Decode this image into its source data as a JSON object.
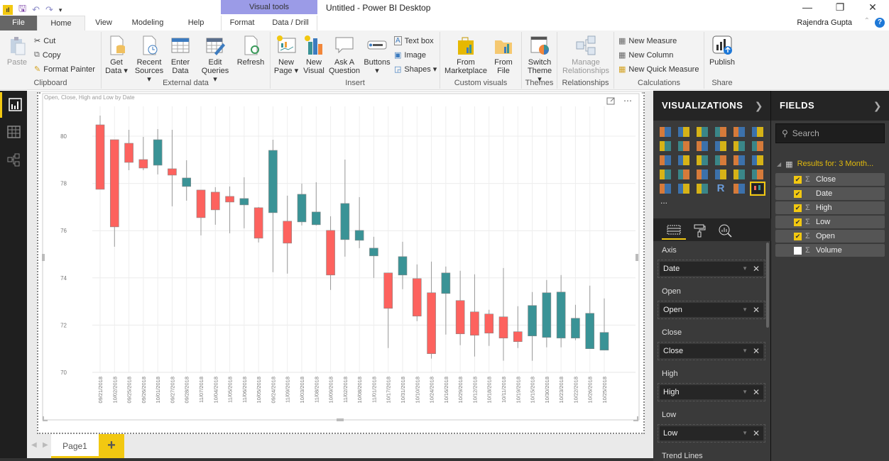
{
  "window": {
    "title": "Untitled - Power BI Desktop",
    "contextual_group": "Visual tools",
    "controls": [
      "minimize",
      "restore",
      "close"
    ],
    "user": "Rajendra Gupta"
  },
  "tabs": [
    {
      "label": "File",
      "active": false
    },
    {
      "label": "Home",
      "active": true
    },
    {
      "label": "View",
      "active": false
    },
    {
      "label": "Modeling",
      "active": false
    },
    {
      "label": "Help",
      "active": false
    },
    {
      "label": "Format",
      "active": false
    },
    {
      "label": "Data / Drill",
      "active": false
    }
  ],
  "ribbon": {
    "clipboard": {
      "label": "Clipboard",
      "paste": "Paste",
      "cut": "Cut",
      "copy": "Copy",
      "format_painter": "Format Painter"
    },
    "external_data": {
      "label": "External data",
      "get_data": [
        "Get",
        "Data ▾"
      ],
      "recent_sources": [
        "Recent",
        "Sources ▾"
      ],
      "enter_data": [
        "Enter",
        "Data"
      ],
      "edit_queries": [
        "Edit",
        "Queries ▾"
      ],
      "refresh": "Refresh"
    },
    "insert": {
      "label": "Insert",
      "new_page": [
        "New",
        "Page ▾"
      ],
      "new_visual": [
        "New",
        "Visual"
      ],
      "ask_question": [
        "Ask A",
        "Question"
      ],
      "buttons": [
        "Buttons",
        "▾"
      ],
      "text_box": "Text box",
      "image": "Image",
      "shapes": "Shapes ▾"
    },
    "custom_visuals": {
      "label": "Custom visuals",
      "from_marketplace": [
        "From",
        "Marketplace"
      ],
      "from_file": [
        "From",
        "File"
      ]
    },
    "themes": {
      "label": "Themes",
      "switch_theme": [
        "Switch",
        "Theme ▾"
      ]
    },
    "relationships": {
      "label": "Relationships",
      "manage": [
        "Manage",
        "Relationships"
      ]
    },
    "calculations": {
      "label": "Calculations",
      "new_measure": "New Measure",
      "new_column": "New Column",
      "new_quick_measure": "New Quick Measure"
    },
    "share": {
      "label": "Share",
      "publish": "Publish"
    }
  },
  "left_nav": [
    {
      "name": "report-view",
      "active": true
    },
    {
      "name": "data-view",
      "active": false
    },
    {
      "name": "relationships-view",
      "active": false
    }
  ],
  "pages": {
    "tabs": [
      "Page1"
    ],
    "add_label": "+"
  },
  "visualizations": {
    "title": "VISUALIZATIONS",
    "more": "...",
    "wells": [
      {
        "label": "Axis",
        "field": "Date"
      },
      {
        "label": "Open",
        "field": "Open"
      },
      {
        "label": "Close",
        "field": "Close"
      },
      {
        "label": "High",
        "field": "High"
      },
      {
        "label": "Low",
        "field": "Low"
      },
      {
        "label": "Trend Lines",
        "field": null
      }
    ]
  },
  "fields": {
    "title": "FIELDS",
    "search_placeholder": "Search",
    "table": "Results for: 3 Month...",
    "items": [
      {
        "name": "Close",
        "checked": true,
        "sigma": true
      },
      {
        "name": "Date",
        "checked": true,
        "sigma": false
      },
      {
        "name": "High",
        "checked": true,
        "sigma": true
      },
      {
        "name": "Low",
        "checked": true,
        "sigma": true
      },
      {
        "name": "Open",
        "checked": true,
        "sigma": true
      },
      {
        "name": "Volume",
        "checked": false,
        "sigma": true
      }
    ]
  },
  "colors": {
    "up": "#3a9396",
    "down": "#fd625e",
    "accent": "#f2c811"
  },
  "chart_data": {
    "type": "candlestick",
    "title": "Open, Close, High and Low by Date",
    "xlabel": "",
    "ylabel": "",
    "ylim": [
      70,
      81
    ],
    "yticks": [
      70,
      72,
      74,
      76,
      78,
      80
    ],
    "grid": true,
    "categories": [
      "09/21/2018",
      "10/02/2018",
      "09/25/2018",
      "09/26/2018",
      "10/01/2018",
      "09/27/2018",
      "09/28/2018",
      "11/07/2018",
      "10/04/2018",
      "11/05/2018",
      "11/06/2018",
      "10/05/2018",
      "09/24/2018",
      "11/09/2018",
      "10/03/2018",
      "11/08/2018",
      "10/09/2018",
      "11/02/2018",
      "10/08/2018",
      "11/01/2018",
      "10/17/2018",
      "10/31/2018",
      "10/10/2018",
      "10/24/2018",
      "10/16/2018",
      "10/29/2018",
      "10/12/2018",
      "10/18/2018",
      "10/11/2018",
      "10/19/2018",
      "10/15/2018",
      "10/30/2018",
      "10/23/2018",
      "10/22/2018",
      "10/26/2018",
      "10/25/2018"
    ],
    "open": [
      80.48,
      79.85,
      79.7,
      79.01,
      78.77,
      78.62,
      77.87,
      77.72,
      77.63,
      77.45,
      77.09,
      76.97,
      76.76,
      76.4,
      76.37,
      76.25,
      76.01,
      75.62,
      75.59,
      74.93,
      74.21,
      74.12,
      73.97,
      73.37,
      73.34,
      73.04,
      72.56,
      72.47,
      72.35,
      71.72,
      71.54,
      71.48,
      71.45,
      71.45,
      71.0,
      70.94
    ],
    "close": [
      77.75,
      76.16,
      78.89,
      78.65,
      79.85,
      78.35,
      78.23,
      76.55,
      76.88,
      77.21,
      77.36,
      75.68,
      79.4,
      75.47,
      77.54,
      76.79,
      74.12,
      77.15,
      76.01,
      75.26,
      72.71,
      74.9,
      72.38,
      70.79,
      74.21,
      71.63,
      71.57,
      71.66,
      71.45,
      71.3,
      72.83,
      73.37,
      73.4,
      72.29,
      72.5,
      71.69
    ],
    "high": [
      80.87,
      79.85,
      80.27,
      79.97,
      80.3,
      80.27,
      78.98,
      77.72,
      77.84,
      77.87,
      78.26,
      77.0,
      79.85,
      77.48,
      77.99,
      78.05,
      76.61,
      79.01,
      77.42,
      75.74,
      74.21,
      75.53,
      74.57,
      74.69,
      74.48,
      74.3,
      74.15,
      72.65,
      74.42,
      72.8,
      73.4,
      73.91,
      74.12,
      72.86,
      73.67,
      73.13
    ],
    "low": [
      77.75,
      75.32,
      78.56,
      78.56,
      78.38,
      77.03,
      77.27,
      75.8,
      76.25,
      75.89,
      76.1,
      75.5,
      74.24,
      74.18,
      76.22,
      76.22,
      73.49,
      74.9,
      75.26,
      74.0,
      71.03,
      73.52,
      72.17,
      70.58,
      71.6,
      71.15,
      70.67,
      71.12,
      70.49,
      71.03,
      70.49,
      71.06,
      71.06,
      71.36,
      71.0,
      70.94
    ]
  }
}
